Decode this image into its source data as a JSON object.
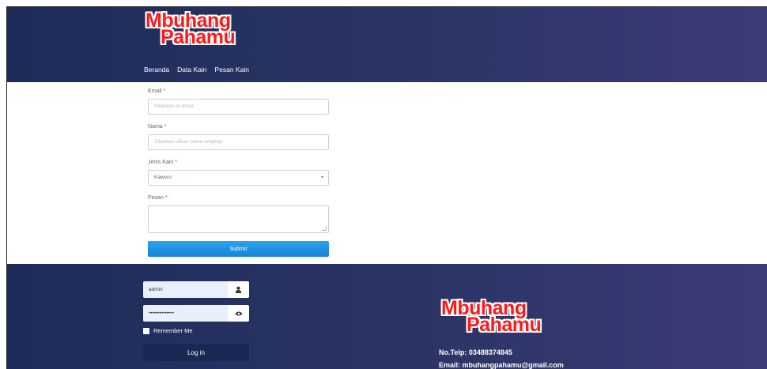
{
  "brand": {
    "line1": "Mbuhang",
    "line2": "Pahamu"
  },
  "nav": [
    "Beranda",
    "Data Kain",
    "Pesan Kain"
  ],
  "form": {
    "email": {
      "label": "Email",
      "required": "*",
      "placeholder": "Silahkan isi email"
    },
    "nama": {
      "label": "Nama",
      "required": "*",
      "placeholder": "Silahkan isikan nama lengkap"
    },
    "jenis_kain": {
      "label": "Jenis Kain",
      "required": "*",
      "value": "Kawuru"
    },
    "pesan": {
      "label": "Pesan",
      "required": "*",
      "value": ""
    },
    "submit_label": "Submit"
  },
  "login": {
    "username_value": "admin",
    "password_value": "••••••••••••••",
    "remember_label": "Remember Me",
    "submit_label": "Log in"
  },
  "footer": {
    "phone": "No.Telp: 03488374845",
    "email": "Email: mbuhangpahamu@gmail.com"
  },
  "colors": {
    "header_bg": "#1e2c5a",
    "accent_button": "#1e90e6",
    "logo_red": "#ff1a1a"
  }
}
